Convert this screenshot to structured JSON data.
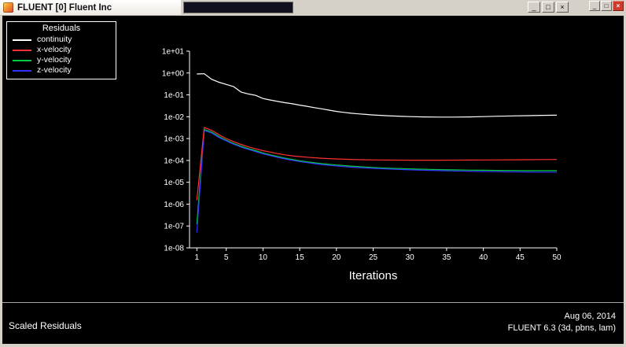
{
  "window": {
    "title": "FLUENT [0] Fluent Inc",
    "controls": {
      "minimize": "_",
      "maximize": "□",
      "close": "×"
    }
  },
  "outer_window": {
    "controls": {
      "minimize": "_",
      "maximize": "□",
      "close": "×"
    }
  },
  "legend": {
    "title": "Residuals"
  },
  "footer": {
    "caption": "Scaled Residuals",
    "date": "Aug 06, 2014",
    "version": "FLUENT 6.3 (3d, pbns, lam)"
  },
  "chart_data": {
    "type": "line",
    "title": "Scaled Residuals",
    "xlabel": "Iterations",
    "background": "#000000",
    "grid": false,
    "legend_position": "top-left",
    "x_axis": {
      "min": 0,
      "max": 50,
      "ticks": [
        1,
        5,
        10,
        15,
        20,
        25,
        30,
        35,
        40,
        45,
        50
      ]
    },
    "y_axis": {
      "scale": "log",
      "min": 1e-08,
      "max": 10,
      "tick_labels": [
        "1e+01",
        "1e+00",
        "1e-01",
        "1e-02",
        "1e-03",
        "1e-04",
        "1e-05",
        "1e-06",
        "1e-07",
        "1e-08"
      ]
    },
    "draw_order": [
      0,
      2,
      3,
      1
    ],
    "series": [
      {
        "name": "continuity",
        "color": "#ffffff",
        "points": [
          [
            1,
            0.9
          ],
          [
            2,
            0.93
          ],
          [
            3,
            0.52
          ],
          [
            4,
            0.38
          ],
          [
            5,
            0.3
          ],
          [
            6,
            0.24
          ],
          [
            7,
            0.135
          ],
          [
            8,
            0.11
          ],
          [
            9,
            0.095
          ],
          [
            10,
            0.068
          ],
          [
            11,
            0.058
          ],
          [
            12,
            0.05
          ],
          [
            13,
            0.044
          ],
          [
            14,
            0.039
          ],
          [
            15,
            0.034
          ],
          [
            16,
            0.03
          ],
          [
            17,
            0.026
          ],
          [
            18,
            0.023
          ],
          [
            19,
            0.02
          ],
          [
            20,
            0.0175
          ],
          [
            21,
            0.0158
          ],
          [
            22,
            0.0145
          ],
          [
            23,
            0.0135
          ],
          [
            24,
            0.0127
          ],
          [
            25,
            0.012
          ],
          [
            26,
            0.0115
          ],
          [
            27,
            0.0111
          ],
          [
            28,
            0.0107
          ],
          [
            29,
            0.0104
          ],
          [
            30,
            0.0101
          ],
          [
            32,
            0.0098
          ],
          [
            34,
            0.0096
          ],
          [
            36,
            0.0096
          ],
          [
            38,
            0.0098
          ],
          [
            40,
            0.0101
          ],
          [
            42,
            0.0105
          ],
          [
            44,
            0.0109
          ],
          [
            46,
            0.0112
          ],
          [
            48,
            0.0115
          ],
          [
            50,
            0.0117
          ]
        ]
      },
      {
        "name": "x-velocity",
        "color": "#ff3030",
        "points": [
          [
            1,
            1.5e-06
          ],
          [
            2,
            0.0032
          ],
          [
            3,
            0.0024
          ],
          [
            4,
            0.0015
          ],
          [
            5,
            0.001
          ],
          [
            6,
            0.00072
          ],
          [
            7,
            0.00054
          ],
          [
            8,
            0.00042
          ],
          [
            9,
            0.00034
          ],
          [
            10,
            0.00028
          ],
          [
            11,
            0.00024
          ],
          [
            12,
            0.000205
          ],
          [
            13,
            0.00018
          ],
          [
            14,
            0.000162
          ],
          [
            15,
            0.00015
          ],
          [
            16,
            0.00014
          ],
          [
            17,
            0.000132
          ],
          [
            18,
            0.000126
          ],
          [
            19,
            0.000121
          ],
          [
            20,
            0.000117
          ],
          [
            22,
            0.000111
          ],
          [
            24,
            0.000107
          ],
          [
            26,
            0.000105
          ],
          [
            28,
            0.000103
          ],
          [
            30,
            0.000102
          ],
          [
            32,
            0.000102
          ],
          [
            34,
            0.000102
          ],
          [
            36,
            0.000103
          ],
          [
            38,
            0.000104
          ],
          [
            40,
            0.000105
          ],
          [
            42,
            0.000106
          ],
          [
            44,
            0.000107
          ],
          [
            46,
            0.000108
          ],
          [
            48,
            0.000109
          ],
          [
            50,
            0.00011
          ]
        ]
      },
      {
        "name": "y-velocity",
        "color": "#00cc44",
        "points": [
          [
            1,
            1.2e-07
          ],
          [
            2,
            0.0026
          ],
          [
            3,
            0.002
          ],
          [
            4,
            0.00125
          ],
          [
            5,
            0.00085
          ],
          [
            6,
            0.0006
          ],
          [
            7,
            0.00045
          ],
          [
            8,
            0.00035
          ],
          [
            9,
            0.00028
          ],
          [
            10,
            0.00022
          ],
          [
            11,
            0.00018
          ],
          [
            12,
            0.00015
          ],
          [
            13,
            0.000127
          ],
          [
            14,
            0.00011
          ],
          [
            15,
            9.6e-05
          ],
          [
            16,
            8.6e-05
          ],
          [
            17,
            7.8e-05
          ],
          [
            18,
            7.1e-05
          ],
          [
            19,
            6.6e-05
          ],
          [
            20,
            6.2e-05
          ],
          [
            22,
            5.5e-05
          ],
          [
            24,
            5e-05
          ],
          [
            26,
            4.6e-05
          ],
          [
            28,
            4.3e-05
          ],
          [
            30,
            4.1e-05
          ],
          [
            32,
            3.95e-05
          ],
          [
            34,
            3.8e-05
          ],
          [
            36,
            3.7e-05
          ],
          [
            38,
            3.6e-05
          ],
          [
            40,
            3.55e-05
          ],
          [
            42,
            3.5e-05
          ],
          [
            44,
            3.45e-05
          ],
          [
            46,
            3.4e-05
          ],
          [
            48,
            3.4e-05
          ],
          [
            50,
            3.4e-05
          ]
        ]
      },
      {
        "name": "z-velocity",
        "color": "#3333ff",
        "points": [
          [
            1,
            5e-08
          ],
          [
            2,
            0.0023
          ],
          [
            3,
            0.0018
          ],
          [
            4,
            0.00112
          ],
          [
            5,
            0.00078
          ],
          [
            6,
            0.00055
          ],
          [
            7,
            0.00041
          ],
          [
            8,
            0.00032
          ],
          [
            9,
            0.00025
          ],
          [
            10,
            0.0002
          ],
          [
            11,
            0.000165
          ],
          [
            12,
            0.000138
          ],
          [
            13,
            0.000117
          ],
          [
            14,
            0.000101
          ],
          [
            15,
            8.8e-05
          ],
          [
            16,
            7.9e-05
          ],
          [
            17,
            7.1e-05
          ],
          [
            18,
            6.5e-05
          ],
          [
            19,
            6e-05
          ],
          [
            20,
            5.6e-05
          ],
          [
            22,
            4.9e-05
          ],
          [
            24,
            4.5e-05
          ],
          [
            26,
            4.2e-05
          ],
          [
            28,
            3.9e-05
          ],
          [
            30,
            3.7e-05
          ],
          [
            32,
            3.55e-05
          ],
          [
            34,
            3.4e-05
          ],
          [
            36,
            3.3e-05
          ],
          [
            38,
            3.2e-05
          ],
          [
            40,
            3.1e-05
          ],
          [
            42,
            3.05e-05
          ],
          [
            44,
            3e-05
          ],
          [
            46,
            2.95e-05
          ],
          [
            48,
            2.9e-05
          ],
          [
            50,
            2.9e-05
          ]
        ]
      }
    ]
  }
}
